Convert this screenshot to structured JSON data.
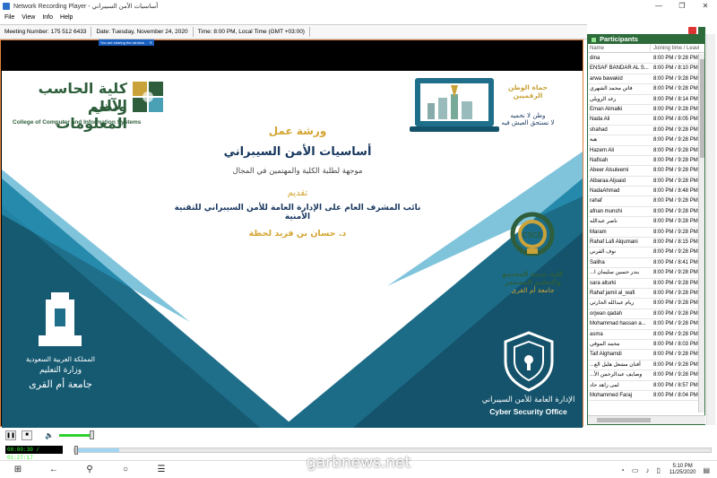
{
  "window": {
    "title": "Network Recording Player - أساسيات الأمن السيبراني"
  },
  "menu": [
    "File",
    "View",
    "Info",
    "Help"
  ],
  "info": {
    "meeting_number": "Meeting Number: 175 512 6433",
    "date": "Date: Tuesday, November 24, 2020",
    "time": "Time: 8:00 PM, Local Time (GMT +03:00)"
  },
  "share_indicator": {
    "text": "You are sharing the window",
    "close": "✕"
  },
  "slide": {
    "college_ar_1": "كلية الحاسب الآلي",
    "college_ar_2": "ونظم المعلومات",
    "college_en": "College of Computer and Information Systems",
    "slogan_1": "حماة الوطن الرقميين",
    "slogan_2": "وطن لا نحميه",
    "slogan_3": "لا نستحق العيش فيه",
    "workshop": "ورشة عمل",
    "workshop_title": "أساسيات الأمن السيبراني",
    "workshop_subtitle": "موجهة لطلبة الكلية والمهتمين في المجال",
    "presenting": "تقديم",
    "presenter_role": "نائب المشرف العام على الإدارة العامة للأمن السيبراني للتقنية الأمنية",
    "presenter_name": "د. حسان بن فريد لحظة",
    "csce_badge": "CSCE",
    "csce_1": "كلية خدمة المجتمع",
    "csce_2": "والتعليم المستمر",
    "csce_3": "جامعة أم القرى",
    "moe_kingdom": "المملكة العربية السعودية",
    "moe_ministry": "وزارة التعليم",
    "moe_university": "جامعة أم القرى",
    "cso_ar": "الإدارة العامة للأمن السيبراني",
    "cso_en": "Cyber Security Office"
  },
  "participants": {
    "title": "Participants",
    "col_name": "Name",
    "col_time": "Joining time / Leaving time",
    "rows": [
      {
        "name": "dina",
        "time": "8:00 PM / 9:28 PM"
      },
      {
        "name": "ENSAF BANDAR AL S...",
        "time": "8:00 PM / 8:10 PM"
      },
      {
        "name": "arwa bawakid",
        "time": "8:00 PM / 9:28 PM"
      },
      {
        "name": "فاتن محمد الشهري",
        "time": "8:00 PM / 9:28 PM"
      },
      {
        "name": "رغد الزويلي",
        "time": "8:00 PM / 8:14 PM"
      },
      {
        "name": "Eman Almalki",
        "time": "8:00 PM / 9:28 PM"
      },
      {
        "name": "Nada Ali",
        "time": "8:00 PM / 8:05 PM"
      },
      {
        "name": "shahad",
        "time": "8:00 PM / 9:28 PM"
      },
      {
        "name": "هبة",
        "time": "8:00 PM / 9:28 PM"
      },
      {
        "name": "Hazem Ali",
        "time": "8:00 PM / 9:28 PM"
      },
      {
        "name": "Nafisah",
        "time": "8:00 PM / 9:28 PM"
      },
      {
        "name": "Abeer Alsuleemi",
        "time": "8:00 PM / 9:28 PM"
      },
      {
        "name": "Albaraa Aljuaid",
        "time": "8:00 PM / 9:28 PM"
      },
      {
        "name": "NadaAhmad",
        "time": "8:00 PM / 8:48 PM"
      },
      {
        "name": "rahaf",
        "time": "8:00 PM / 9:28 PM"
      },
      {
        "name": "afnan munshi",
        "time": "8:00 PM / 9:28 PM"
      },
      {
        "name": "ناصر عبدالله",
        "time": "8:00 PM / 9:28 PM"
      },
      {
        "name": "Maram",
        "time": "8:00 PM / 9:28 PM"
      },
      {
        "name": "Rahaf Lafi Alqumani",
        "time": "8:00 PM / 8:15 PM"
      },
      {
        "name": "نوف القرني",
        "time": "8:00 PM / 9:28 PM"
      },
      {
        "name": "Saliha",
        "time": "8:00 PM / 8:41 PM"
      },
      {
        "name": "...بندر حسين سليمان ا",
        "time": "8:00 PM / 9:28 PM"
      },
      {
        "name": "sara alturki",
        "time": "8:00 PM / 9:28 PM"
      },
      {
        "name": "Rahaf jamil al_wafi",
        "time": "8:00 PM / 9:28 PM"
      },
      {
        "name": "ريام عبدالله الحارثي",
        "time": "8:00 PM / 9:28 PM"
      },
      {
        "name": "orjwan qadah",
        "time": "8:00 PM / 9:28 PM"
      },
      {
        "name": "Mohammad hassan a...",
        "time": "8:00 PM / 9:28 PM"
      },
      {
        "name": "asma",
        "time": "8:00 PM / 9:28 PM"
      },
      {
        "name": "محمد الموقي",
        "time": "8:00 PM / 8:03 PM"
      },
      {
        "name": "Taif Alghamdi",
        "time": "8:00 PM / 9:28 PM"
      },
      {
        "name": "...أفنان مشعل هليل الع",
        "time": "8:00 PM / 9:28 PM"
      },
      {
        "name": "...وصايف عبدالرحمن الأ",
        "time": "8:00 PM / 9:28 PM"
      },
      {
        "name": "لمى زاهد حاد",
        "time": "8:00 PM / 8:57 PM"
      },
      {
        "name": "Mohammed Faraj",
        "time": "8:00 PM / 8:04 PM"
      }
    ]
  },
  "player": {
    "pause": "❚❚",
    "stop": "■",
    "volume_icon": "🔈",
    "volume_level": 0.9,
    "time_readout": "00:00:30 / 01:27:17",
    "buffer_progress": 0.07
  },
  "taskbar": {
    "clock_time": "5:10 PM",
    "clock_date": "11/25/2020"
  },
  "watermark": "garbnews.net",
  "colors": {
    "accent_green": "#2d6b3a",
    "slide_teal": "#1f6f8b",
    "slide_gold": "#d4a531",
    "slide_navy": "#17375e",
    "recording_border": "#e0803a"
  },
  "icons": {
    "app": "app-icon",
    "windows": "windows-start-icon",
    "back": "back-arrow-icon",
    "search": "search-icon",
    "cortana": "circle-icon",
    "task_view": "task-view-icon"
  }
}
